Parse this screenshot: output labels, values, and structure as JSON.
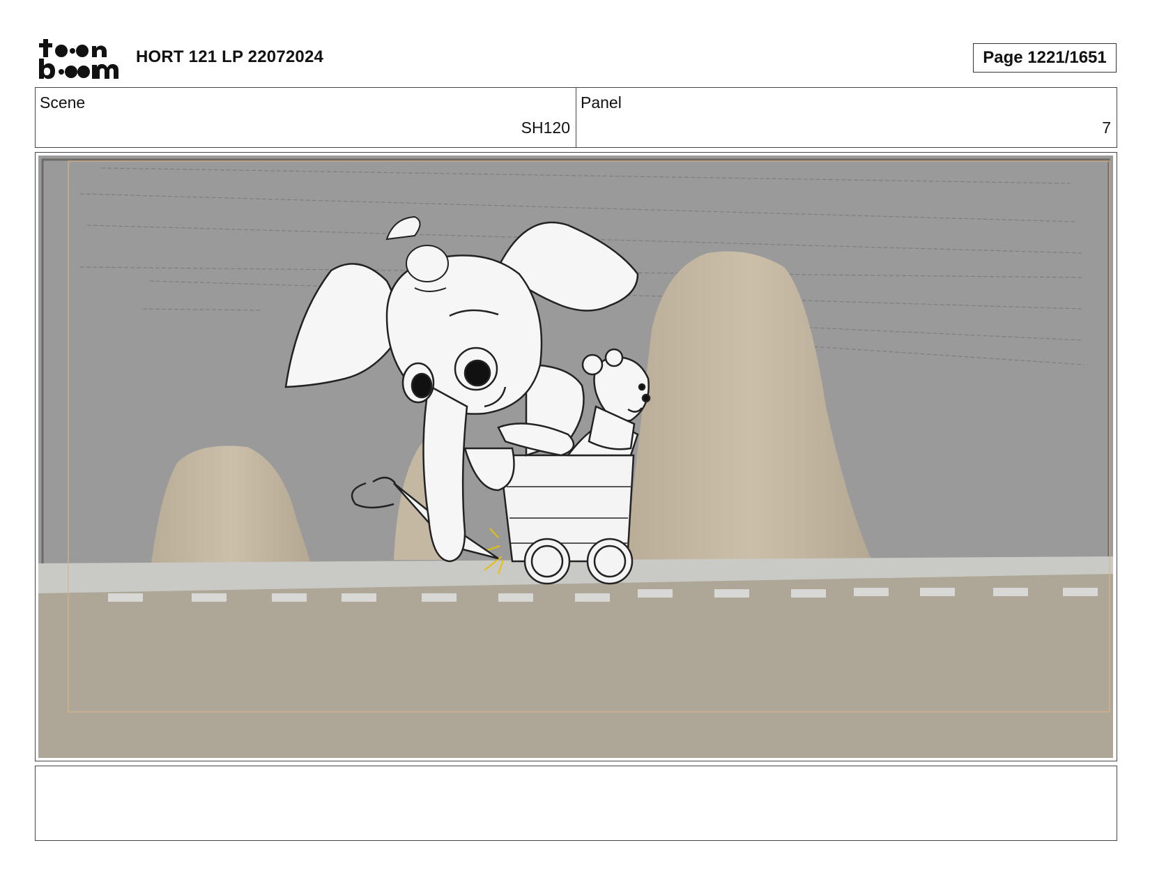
{
  "header": {
    "logo_text": "toon boom",
    "project_title": "HORT 121 LP 22072024",
    "page_indicator": "Page 1221/1651"
  },
  "info": {
    "scene_label": "Scene",
    "scene_value": "SH120",
    "panel_label": "Panel",
    "panel_value": "7"
  },
  "panel_image": {
    "description_icon": "storyboard-sketch-elephant-mine-cart"
  },
  "notes": {
    "text": ""
  }
}
